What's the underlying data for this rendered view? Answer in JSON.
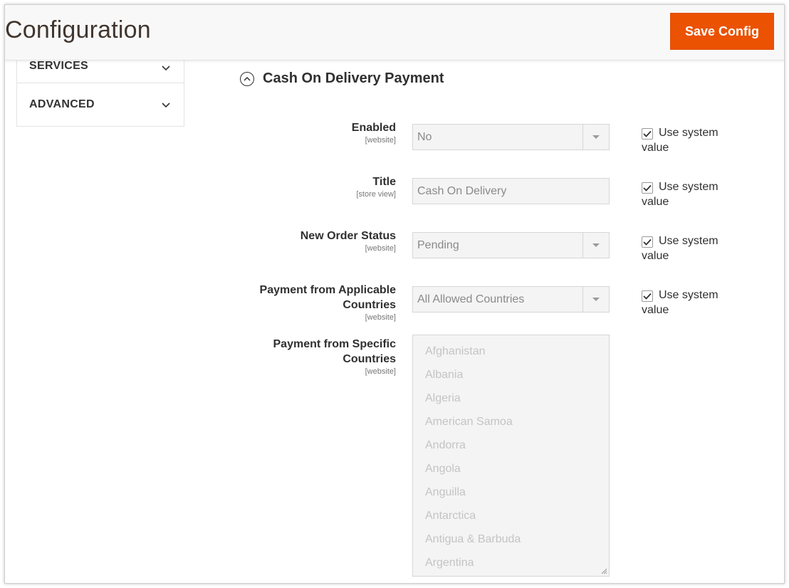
{
  "header": {
    "title": "Configuration",
    "save_label": "Save Config"
  },
  "sidebar": {
    "items": [
      {
        "label": "SERVICES"
      },
      {
        "label": "ADVANCED"
      }
    ]
  },
  "section": {
    "title": "Cash On Delivery Payment"
  },
  "fields": [
    {
      "label": "Enabled",
      "scope": "[website]",
      "value": "No",
      "type": "select"
    },
    {
      "label": "Title",
      "scope": "[store view]",
      "value": "Cash On Delivery",
      "type": "text"
    },
    {
      "label": "New Order Status",
      "scope": "[website]",
      "value": "Pending",
      "type": "select"
    },
    {
      "label": "Payment from Applicable Countries",
      "scope": "[website]",
      "value": "All Allowed Countries",
      "type": "select"
    }
  ],
  "use_system_value": {
    "label": "Use system value",
    "checked": true
  },
  "specific_countries": {
    "label": "Payment from Specific Countries",
    "scope": "[website]",
    "options": [
      "Afghanistan",
      "Albania",
      "Algeria",
      "American Samoa",
      "Andorra",
      "Angola",
      "Anguilla",
      "Antarctica",
      "Antigua & Barbuda",
      "Argentina"
    ]
  },
  "colors": {
    "accent": "#eb5202",
    "title_text": "#41362f",
    "disabled_bg": "#f4f4f4"
  }
}
